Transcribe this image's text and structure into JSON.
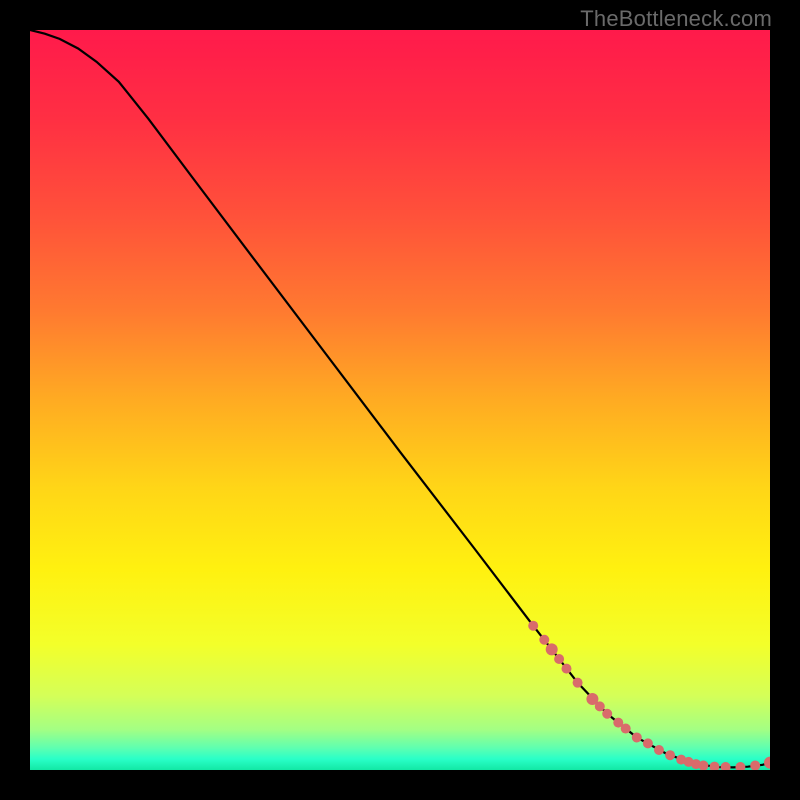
{
  "watermark": "TheBottleneck.com",
  "chart_data": {
    "type": "line",
    "title": "",
    "xlabel": "",
    "ylabel": "",
    "xlim": [
      0,
      100
    ],
    "ylim": [
      0,
      100
    ],
    "gradient_stops": [
      {
        "offset": 0.0,
        "color": "#ff1a4b"
      },
      {
        "offset": 0.12,
        "color": "#ff2f43"
      },
      {
        "offset": 0.25,
        "color": "#ff513a"
      },
      {
        "offset": 0.38,
        "color": "#ff7a30"
      },
      {
        "offset": 0.5,
        "color": "#ffab22"
      },
      {
        "offset": 0.62,
        "color": "#ffd617"
      },
      {
        "offset": 0.73,
        "color": "#fff110"
      },
      {
        "offset": 0.83,
        "color": "#f3ff2a"
      },
      {
        "offset": 0.9,
        "color": "#d4ff58"
      },
      {
        "offset": 0.945,
        "color": "#a4ff83"
      },
      {
        "offset": 0.97,
        "color": "#5fffb0"
      },
      {
        "offset": 0.985,
        "color": "#2affc8"
      },
      {
        "offset": 1.0,
        "color": "#12e8a4"
      }
    ],
    "series": [
      {
        "name": "bottleneck-curve",
        "x": [
          0.0,
          2.0,
          4.0,
          6.5,
          9.0,
          12.0,
          16.0,
          22.0,
          30.0,
          40.0,
          50.0,
          60.0,
          68.0,
          74.0,
          78.0,
          82.0,
          86.0,
          89.0,
          91.5,
          93.0,
          95.0,
          97.0,
          99.0,
          100.0
        ],
        "y": [
          100.0,
          99.5,
          98.8,
          97.5,
          95.7,
          93.0,
          88.0,
          80.0,
          69.4,
          56.2,
          43.0,
          30.0,
          19.5,
          11.8,
          7.6,
          4.4,
          2.2,
          1.1,
          0.6,
          0.4,
          0.35,
          0.45,
          0.7,
          1.0
        ]
      }
    ],
    "data_markers": {
      "name": "highlighted-points",
      "color": "#d96b6b",
      "points": [
        {
          "x": 68.0,
          "y": 19.5,
          "r": 5
        },
        {
          "x": 69.5,
          "y": 17.6,
          "r": 5
        },
        {
          "x": 70.5,
          "y": 16.3,
          "r": 6
        },
        {
          "x": 71.5,
          "y": 15.0,
          "r": 5
        },
        {
          "x": 72.5,
          "y": 13.7,
          "r": 5
        },
        {
          "x": 74.0,
          "y": 11.8,
          "r": 5
        },
        {
          "x": 76.0,
          "y": 9.6,
          "r": 6
        },
        {
          "x": 77.0,
          "y": 8.6,
          "r": 5
        },
        {
          "x": 78.0,
          "y": 7.6,
          "r": 5
        },
        {
          "x": 79.5,
          "y": 6.4,
          "r": 5
        },
        {
          "x": 80.5,
          "y": 5.6,
          "r": 5
        },
        {
          "x": 82.0,
          "y": 4.4,
          "r": 5
        },
        {
          "x": 83.5,
          "y": 3.6,
          "r": 5
        },
        {
          "x": 85.0,
          "y": 2.7,
          "r": 5
        },
        {
          "x": 86.5,
          "y": 2.0,
          "r": 5
        },
        {
          "x": 88.0,
          "y": 1.4,
          "r": 5
        },
        {
          "x": 89.0,
          "y": 1.1,
          "r": 5
        },
        {
          "x": 90.0,
          "y": 0.8,
          "r": 5
        },
        {
          "x": 91.0,
          "y": 0.6,
          "r": 5
        },
        {
          "x": 92.5,
          "y": 0.45,
          "r": 5
        },
        {
          "x": 94.0,
          "y": 0.4,
          "r": 5
        },
        {
          "x": 96.0,
          "y": 0.4,
          "r": 5
        },
        {
          "x": 98.0,
          "y": 0.6,
          "r": 5
        },
        {
          "x": 100.0,
          "y": 1.0,
          "r": 6
        }
      ]
    }
  }
}
